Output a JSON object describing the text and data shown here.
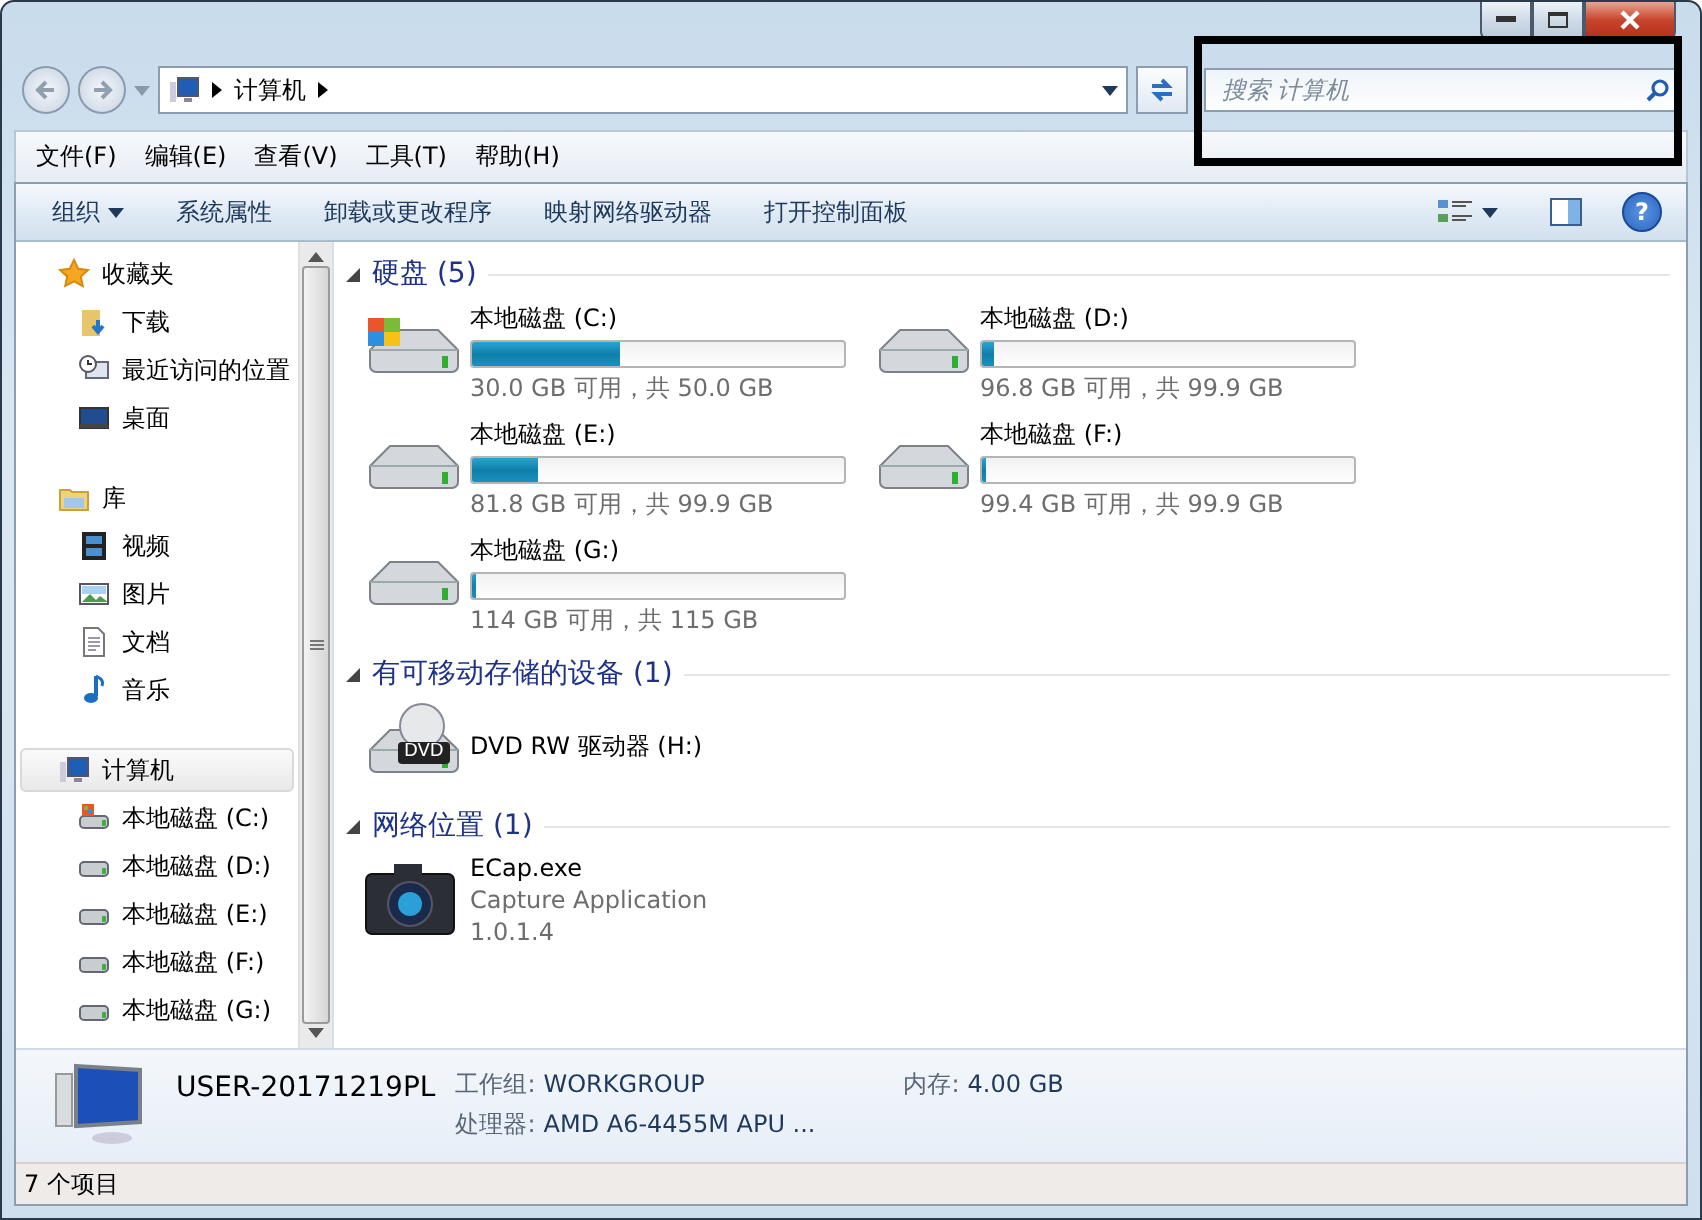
{
  "address": {
    "path": [
      "计算机"
    ]
  },
  "search": {
    "placeholder": "搜索 计算机",
    "highlighted": true
  },
  "menu": [
    "文件(F)",
    "编辑(E)",
    "查看(V)",
    "工具(T)",
    "帮助(H)"
  ],
  "commands": [
    {
      "label": "组织",
      "dropdown": true
    },
    {
      "label": "系统属性",
      "dropdown": false
    },
    {
      "label": "卸载或更改程序",
      "dropdown": false
    },
    {
      "label": "映射网络驱动器",
      "dropdown": false
    },
    {
      "label": "打开控制面板",
      "dropdown": false
    }
  ],
  "sidebar": [
    {
      "label": "收藏夹",
      "kind": "star",
      "selected": false,
      "children": [
        {
          "label": "下载",
          "kind": "download",
          "selected": false
        },
        {
          "label": "最近访问的位置",
          "kind": "recent",
          "selected": false
        },
        {
          "label": "桌面",
          "kind": "desktop",
          "selected": false
        }
      ]
    },
    {
      "label": "库",
      "kind": "library",
      "selected": false,
      "children": [
        {
          "label": "视频",
          "kind": "video",
          "selected": false
        },
        {
          "label": "图片",
          "kind": "picture",
          "selected": false
        },
        {
          "label": "文档",
          "kind": "document",
          "selected": false
        },
        {
          "label": "音乐",
          "kind": "music",
          "selected": false
        }
      ]
    },
    {
      "label": "计算机",
      "kind": "computer",
      "selected": true,
      "children": [
        {
          "label": "本地磁盘 (C:)",
          "kind": "system-drive",
          "selected": false
        },
        {
          "label": "本地磁盘 (D:)",
          "kind": "drive",
          "selected": false
        },
        {
          "label": "本地磁盘 (E:)",
          "kind": "drive",
          "selected": false
        },
        {
          "label": "本地磁盘 (F:)",
          "kind": "drive",
          "selected": false
        },
        {
          "label": "本地磁盘 (G:)",
          "kind": "drive",
          "selected": false
        }
      ]
    }
  ],
  "sections": [
    {
      "title": "硬盘 (5)",
      "expanded": true,
      "items": [
        {
          "kind": "system-drive",
          "name": "本地磁盘 (C:)",
          "level": 0.4,
          "info": "30.0 GB 可用，共 50.0 GB"
        },
        {
          "kind": "drive",
          "name": "本地磁盘 (D:)",
          "level": 0.03,
          "info": "96.8 GB 可用，共 99.9 GB"
        },
        {
          "kind": "drive",
          "name": "本地磁盘 (E:)",
          "level": 0.18,
          "info": "81.8 GB 可用，共 99.9 GB"
        },
        {
          "kind": "drive",
          "name": "本地磁盘 (F:)",
          "level": 0.01,
          "info": "99.4 GB 可用，共 99.9 GB"
        },
        {
          "kind": "drive",
          "name": "本地磁盘 (G:)",
          "level": 0.01,
          "info": "114 GB 可用，共 115 GB"
        }
      ]
    },
    {
      "title": "有可移动存储的设备 (1)",
      "expanded": true,
      "items": [
        {
          "kind": "dvd",
          "name": "DVD RW 驱动器 (H:)",
          "badge": "DVD"
        }
      ]
    },
    {
      "title": "网络位置 (1)",
      "expanded": true,
      "items": [
        {
          "kind": "app",
          "name": "ECap.exe",
          "lines": [
            "Capture Application",
            "1.0.1.4"
          ]
        }
      ]
    }
  ],
  "details": {
    "name": "USER-20171219PL",
    "fields": [
      {
        "label": "工作组:",
        "value": "WORKGROUP"
      },
      {
        "label": "内存:",
        "value": "4.00 GB"
      },
      {
        "label": "处理器:",
        "value": "AMD A6-4455M APU ..."
      }
    ]
  },
  "status_bar": "7 个项目",
  "help": "?"
}
